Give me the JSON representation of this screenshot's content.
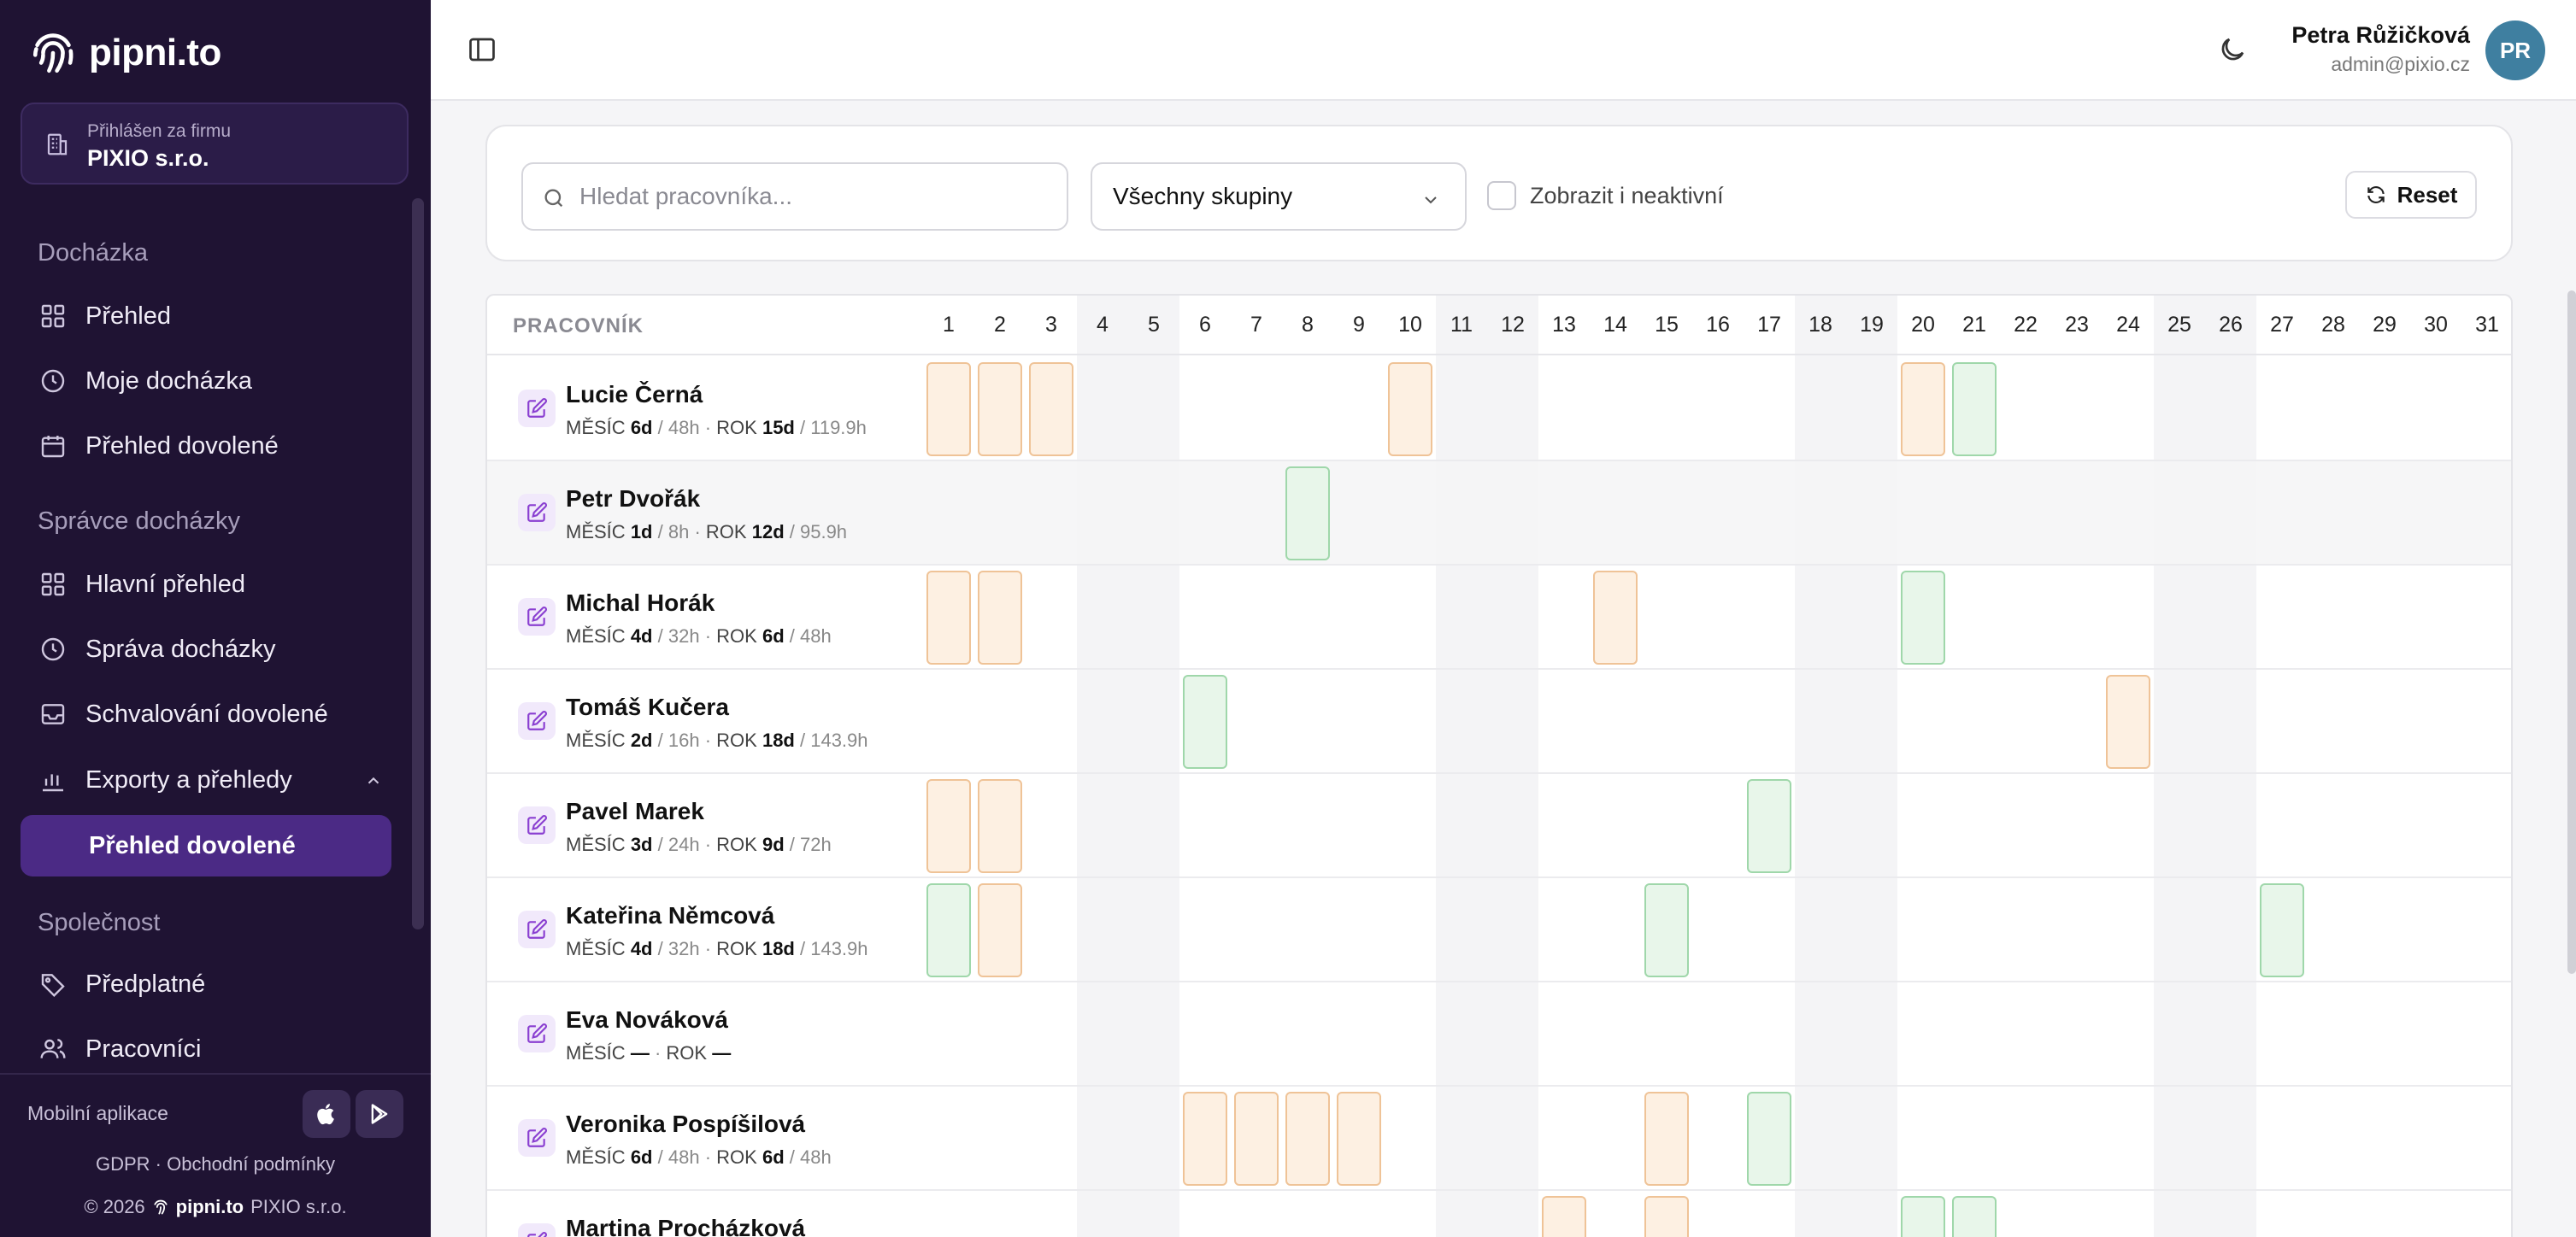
{
  "app": {
    "logo_text": "pipni.to",
    "company_label": "Přihlášen za firmu",
    "company_name": "PIXIO s.r.o."
  },
  "sidebar": {
    "sections": [
      {
        "title": "Docházka",
        "items": [
          "Přehled",
          "Moje docházka",
          "Přehled dovolené"
        ]
      },
      {
        "title": "Správce docházky",
        "items": [
          "Hlavní přehled",
          "Správa docházky",
          "Schvalování dovolené",
          "Exporty a přehledy",
          "Přehled dovolené"
        ]
      },
      {
        "title": "Společnost",
        "items": [
          "Předplatné",
          "Pracovníci"
        ]
      }
    ],
    "mobile_label": "Mobilní aplikace",
    "footer_links": "GDPR · Obchodní podmínky",
    "copyright": "© 2026",
    "copyright_logo": "pipni.to",
    "copyright_company": "PIXIO s.r.o."
  },
  "header": {
    "user_name": "Petra Růžičková",
    "user_email": "admin@pixio.cz",
    "avatar_initials": "PR"
  },
  "filters": {
    "search_placeholder": "Hledat pracovníka...",
    "group_select": "Všechny skupiny",
    "show_inactive_label": "Zobrazit i neaktivní",
    "reset_label": "Reset"
  },
  "table": {
    "column_header": "PRACOVNÍK",
    "days": [
      "1",
      "2",
      "3",
      "4",
      "5",
      "6",
      "7",
      "8",
      "9",
      "10",
      "11",
      "12",
      "13",
      "14",
      "15",
      "16",
      "17",
      "18",
      "19",
      "20",
      "21",
      "22",
      "23",
      "24",
      "25",
      "26",
      "27",
      "28",
      "29",
      "30",
      "31"
    ],
    "weekend_days": [
      4,
      5,
      11,
      12,
      18,
      19,
      25,
      26
    ],
    "month_label": "MĚSÍC",
    "year_label": "ROK",
    "rows": [
      {
        "name": "Lucie Černá",
        "month_days": "6d",
        "month_hours": "/ 48h",
        "year_days": "15d",
        "year_hours": "/ 119.9h",
        "vacation": [
          1,
          2,
          3,
          10,
          20
        ],
        "sick": [
          21
        ]
      },
      {
        "name": "Petr Dvořák",
        "month_days": "1d",
        "month_hours": "/ 8h",
        "year_days": "12d",
        "year_hours": "/ 95.9h",
        "vacation": [],
        "sick": [
          8
        ]
      },
      {
        "name": "Michal Horák",
        "month_days": "4d",
        "month_hours": "/ 32h",
        "year_days": "6d",
        "year_hours": "/ 48h",
        "vacation": [
          1,
          2,
          14
        ],
        "sick": [
          20
        ]
      },
      {
        "name": "Tomáš Kučera",
        "month_days": "2d",
        "month_hours": "/ 16h",
        "year_days": "18d",
        "year_hours": "/ 143.9h",
        "vacation": [
          24
        ],
        "sick": [
          6
        ]
      },
      {
        "name": "Pavel Marek",
        "month_days": "3d",
        "month_hours": "/ 24h",
        "year_days": "9d",
        "year_hours": "/ 72h",
        "vacation": [
          1,
          2
        ],
        "sick": [
          17
        ]
      },
      {
        "name": "Kateřina Němcová",
        "month_days": "4d",
        "month_hours": "/ 32h",
        "year_days": "18d",
        "year_hours": "/ 143.9h",
        "vacation": [
          2
        ],
        "sick": [
          1,
          15,
          27
        ]
      },
      {
        "name": "Eva Nováková",
        "month_days": "—",
        "month_hours": "",
        "year_days": "—",
        "year_hours": "",
        "vacation": [],
        "sick": []
      },
      {
        "name": "Veronika Pospíšilová",
        "month_days": "6d",
        "month_hours": "/ 48h",
        "year_days": "6d",
        "year_hours": "/ 48h",
        "vacation": [
          6,
          7,
          8,
          9,
          15
        ],
        "sick": [
          17
        ]
      },
      {
        "name": "Martina Procházková",
        "month_days": "",
        "month_hours": "",
        "year_days": "",
        "year_hours": "",
        "vacation": [
          13,
          15
        ],
        "sick": [
          20,
          21
        ]
      }
    ]
  }
}
